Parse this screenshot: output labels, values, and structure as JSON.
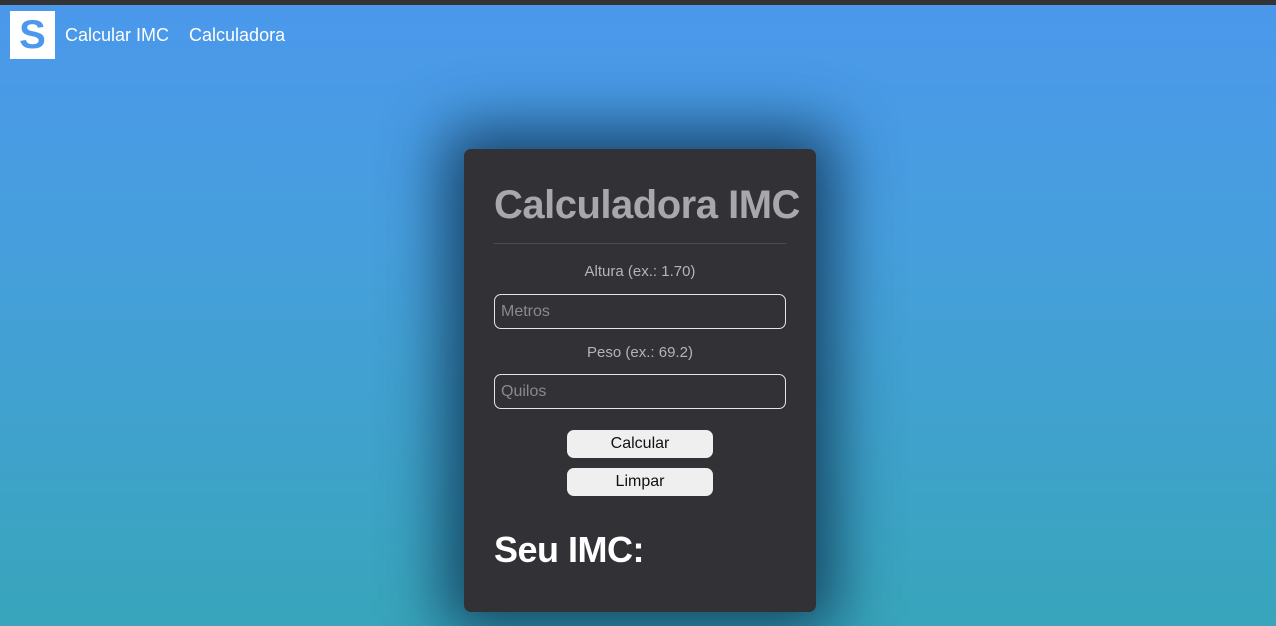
{
  "navbar": {
    "logo_letter": "S",
    "links": [
      {
        "label": "Calcular IMC"
      },
      {
        "label": "Calculadora"
      }
    ]
  },
  "card": {
    "title": "Calculadora IMC",
    "height_field": {
      "label": "Altura (ex.: 1.70)",
      "placeholder": "Metros",
      "value": ""
    },
    "weight_field": {
      "label": "Peso (ex.: 69.2)",
      "placeholder": "Quilos",
      "value": ""
    },
    "calculate_label": "Calcular",
    "clear_label": "Limpar",
    "result_title": "Seu IMC:"
  },
  "colors": {
    "background_top": "#4b98ec",
    "background_bottom": "#38a5bb",
    "card_bg": "#323236",
    "title_color": "#a8a8ac"
  }
}
